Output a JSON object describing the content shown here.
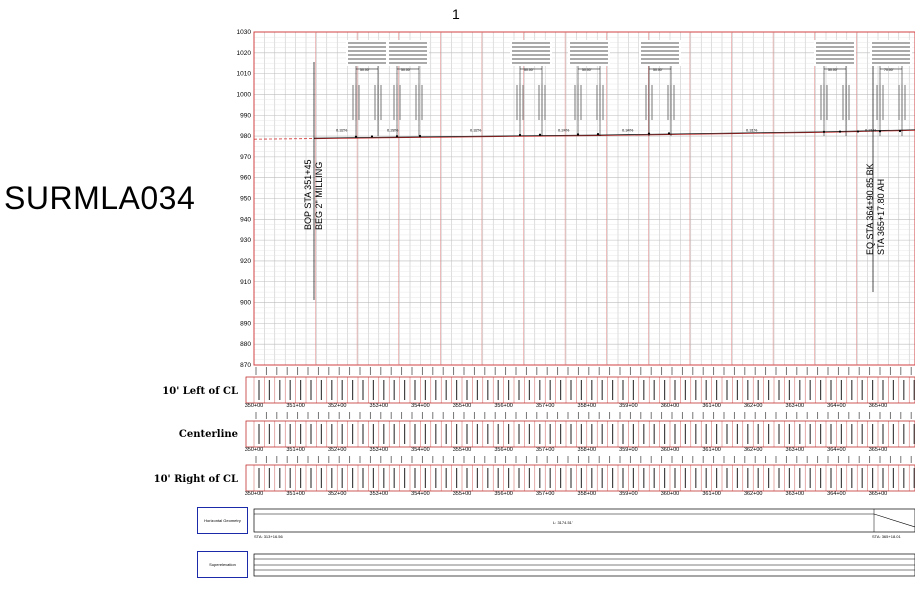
{
  "page_number": "1",
  "sheet_id": "SURMLA034",
  "profile": {
    "y_axis_ticks": [
      "1030",
      "1020",
      "1010",
      "1000",
      "990",
      "980",
      "970",
      "960",
      "950",
      "940",
      "930",
      "920",
      "910",
      "900",
      "890",
      "880",
      "870"
    ],
    "left_callout": [
      "BOP STA 351+45",
      "BEG 2\" MILLING"
    ],
    "right_callout": [
      "EQ STA 364+90.85 BK",
      "STA 365+17.80 AH"
    ],
    "grades": [
      "0.32%",
      "0.28%",
      "0.32%",
      "0.24%",
      "0.34%",
      "0.31%",
      "0.21%"
    ],
    "k_labels": [
      "50.00'",
      "50.00'",
      "50.00'",
      "50.00'",
      "50.00'",
      "50.00'",
      "70.00'"
    ]
  },
  "station_rows": {
    "left_label": "10' Left of CL",
    "center_label": "Centerline",
    "right_label": "10' Right of CL",
    "stations": [
      "350+00",
      "351+00",
      "352+00",
      "353+00",
      "354+00",
      "355+00",
      "356+00",
      "357+00",
      "358+00",
      "359+00",
      "360+00",
      "361+00",
      "362+00",
      "363+00",
      "364+00",
      "365+00"
    ]
  },
  "horizontal_geometry": {
    "box_label": "Horizontal Geometry",
    "length_label": "L: 3174.51'",
    "sta_left": "STA: 313+16.56",
    "sta_right": "STA: 365+18.01"
  },
  "superelevation": {
    "box_label": "Superelevation"
  }
}
